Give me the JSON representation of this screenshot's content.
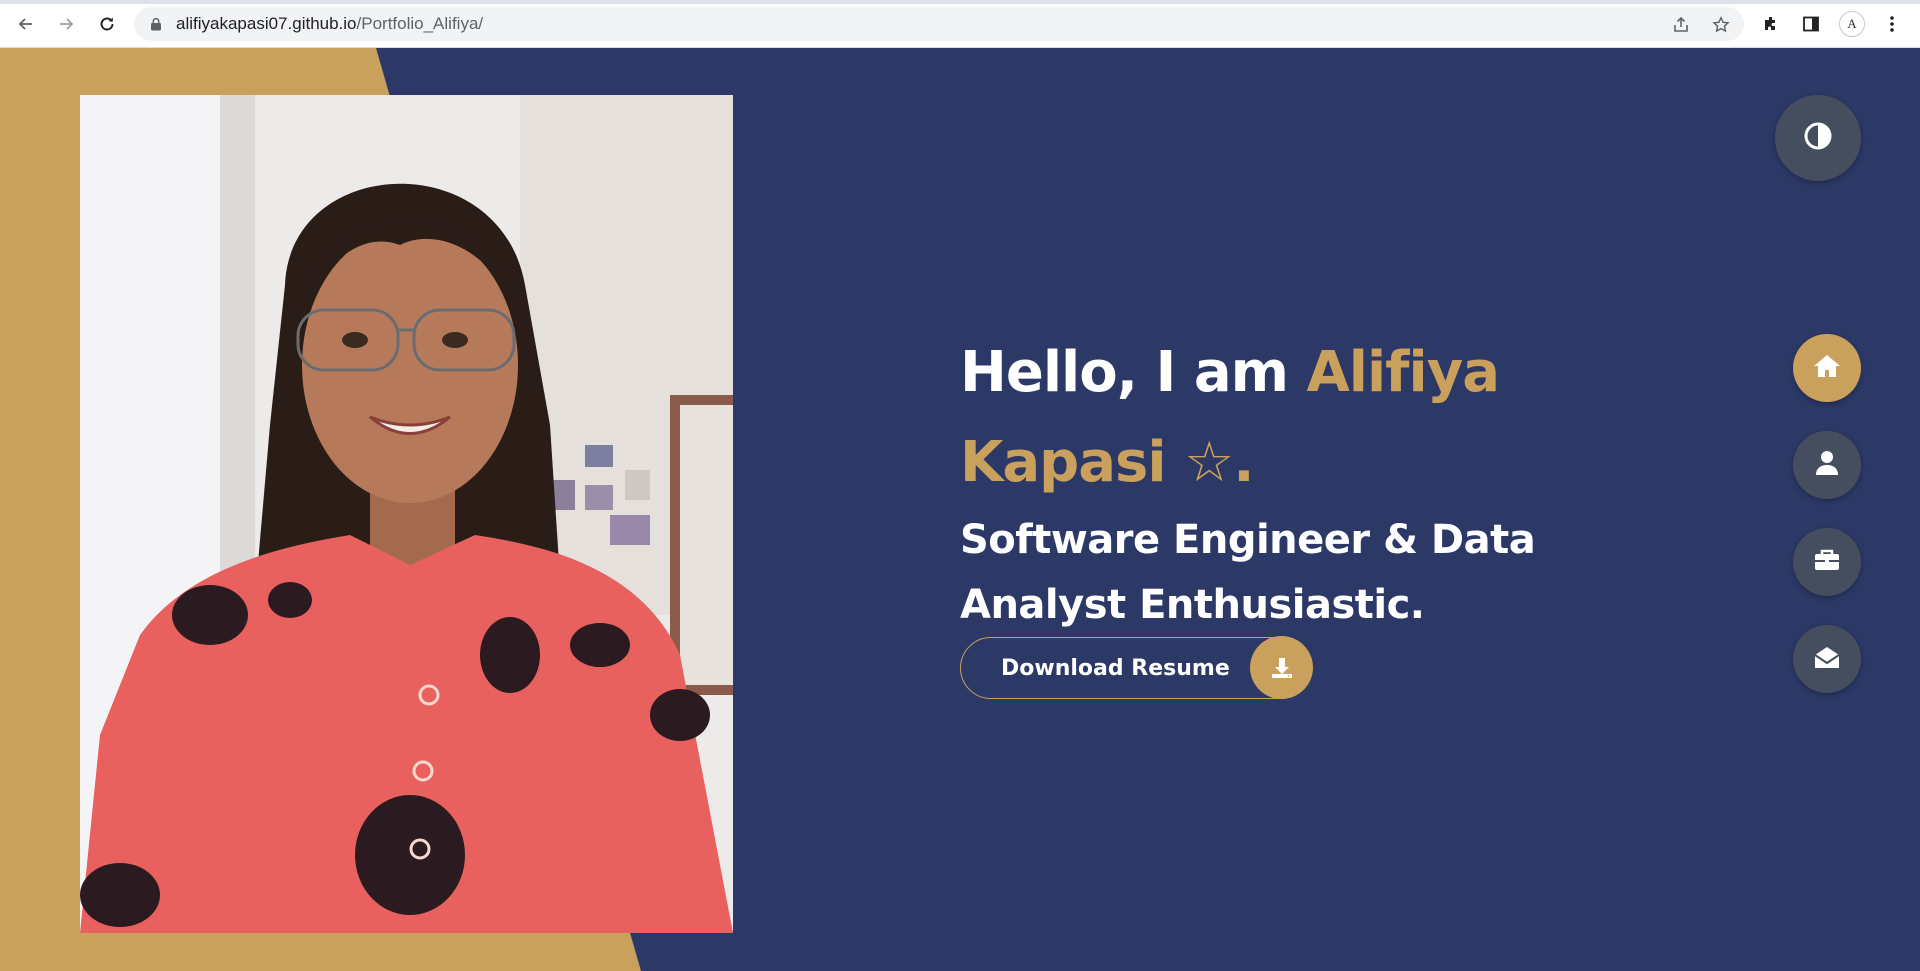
{
  "browser": {
    "url_domain": "alifiyakapasi07.github.io",
    "url_path": "/Portfolio_Alifiya/",
    "profile_initials": "A"
  },
  "hero": {
    "greeting": "Hello, I am ",
    "name": "Alifiya Kapasi ☆.",
    "role": "Software Engineer & Data Analyst Enthusiastic.",
    "download_label": "Download Resume"
  },
  "side_nav": {
    "items": [
      "home",
      "about",
      "portfolio",
      "contact"
    ],
    "active": "home"
  },
  "colors": {
    "background": "#2c3866",
    "accent": "#c9a05c",
    "control": "#454e5e"
  }
}
